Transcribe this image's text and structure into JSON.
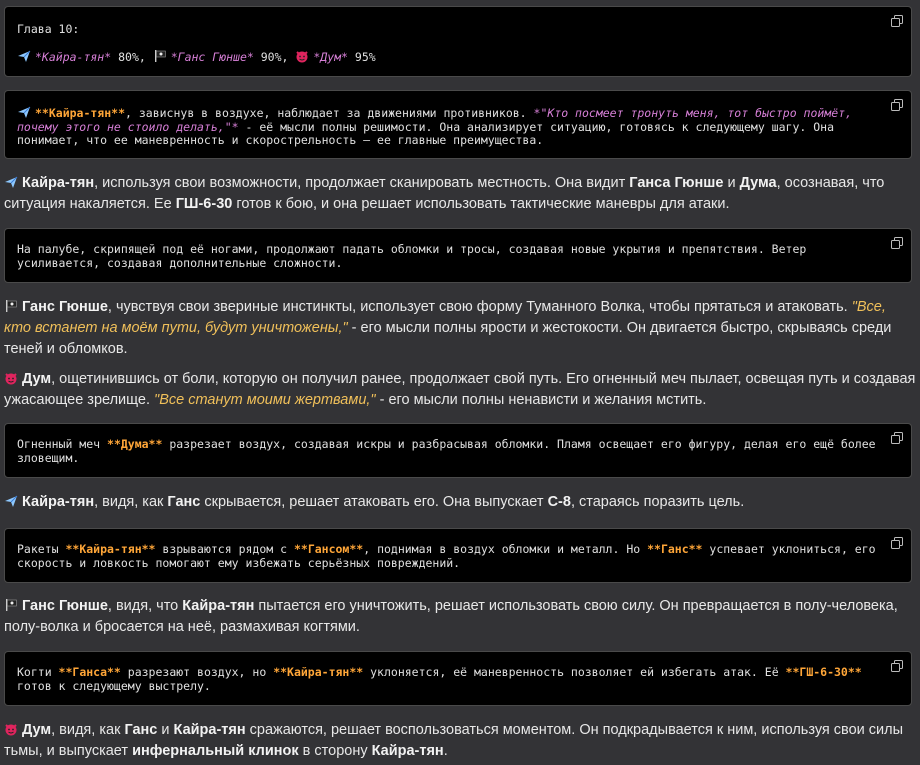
{
  "block1": {
    "line1": "Глава 10:",
    "kaira": "*Кайра-тян*",
    "kaira_pct": " 80%, ",
    "gans": "*Ганс Гюнше*",
    "gans_pct": " 90%, ",
    "dum": "*Дум*",
    "dum_pct": " 95%"
  },
  "block2": {
    "name": "**Кайра-тян**",
    "t1": ", зависнув в воздухе, наблюдает за движениями противников. ",
    "quote": "*\"Кто посмеет тронуть меня, тот быстро поймёт, почему этого не стоило делать,\"*",
    "t2": " - её мысли полны решимости. Она анализирует ситуацию, готовясь к следующему шагу. Она понимает, что ее маневренность и скорострельность — ее главные преимущества."
  },
  "p1": {
    "name": "Кайра-тян",
    "t1": ", используя свои возможности, продолжает сканировать местность. Она видит ",
    "gans": "Ганса Гюнше",
    "t2": " и ",
    "dum": "Дума",
    "t3": ", осознавая, что ситуация накаляется. Ее ",
    "gun": "ГШ-6-30",
    "t4": " готов к бою, и она решает использовать тактические маневры для атаки."
  },
  "block3": {
    "text": "На палубе, скрипящей под её ногами, продолжают падать обломки и тросы, создавая новые укрытия и препятствия. Ветер усиливается, создавая дополнительные сложности."
  },
  "p2": {
    "name": "Ганс Гюнше",
    "t1": ", чувствуя свои звериные инстинкты, использует свою форму Туманного Волка, чтобы прятаться и атаковать. ",
    "quote": "\"Все, кто встанет на моём пути, будут уничтожены,\"",
    "t2": " - его мысли полны ярости и жестокости. Он двигается быстро, скрываясь среди теней и обломков."
  },
  "p3": {
    "name": "Дум",
    "t1": ", ощетинившись от боли, которую он получил ранее, продолжает свой путь. Его огненный меч пылает, освещая путь и создавая ужасающее зрелище. ",
    "quote": "\"Все станут моими жертвами,\"",
    "t2": " - его мысли полны ненависти и желания мстить."
  },
  "block4": {
    "t1": "Огненный меч ",
    "name": "**Дума**",
    "t2": " разрезает воздух, создавая искры и разбрасывая обломки. Пламя освещает его фигуру, делая его ещё более зловещим."
  },
  "p4": {
    "name": "Кайра-тян",
    "t1": ", видя, как ",
    "gans": "Ганс",
    "t2": " скрывается, решает атаковать его. Она выпускает ",
    "missile": "С-8",
    "t3": ", стараясь поразить цель."
  },
  "block5": {
    "t1": "Ракеты ",
    "n1": "**Кайра-тян**",
    "t2": " взрываются рядом с ",
    "n2": "**Гансом**",
    "t3": ", поднимая в воздух обломки и металл. Но ",
    "n3": "**Ганс**",
    "t4": " успевает уклониться, его скорость и ловкость помогают ему избежать серьёзных повреждений."
  },
  "p5": {
    "name": "Ганс Гюнше",
    "t1": ", видя, что ",
    "kaira": "Кайра-тян",
    "t2": " пытается его уничтожить, решает использовать свою силу. Он превращается в полу-человека, полу-волка и бросается на неё, размахивая когтями."
  },
  "block6": {
    "t1": "Когти ",
    "n1": "**Ганса**",
    "t2": " разрезают воздух, но ",
    "n2": "**Кайра-тян**",
    "t3": " уклоняется, её маневренность позволяет ей избегать атак. Её ",
    "n3": "**ГШ-6-30**",
    "t4": " готов к следующему выстрелу."
  },
  "p6": {
    "name": "Дум",
    "t1": ", видя, как ",
    "gans": "Ганс",
    "t2": " и ",
    "kaira": "Кайра-тян",
    "t3": " сражаются, решает воспользоваться моментом. Он подкрадывается к ним, используя свои силы тьмы, и выпускает ",
    "blade": "инфернальный клинок",
    "t4": " в сторону ",
    "kaira2": "Кайра-тян",
    "t5": "."
  },
  "icons": [
    "airplane-icon",
    "pirate-flag-icon",
    "devil-face-icon",
    "copy-icon"
  ]
}
